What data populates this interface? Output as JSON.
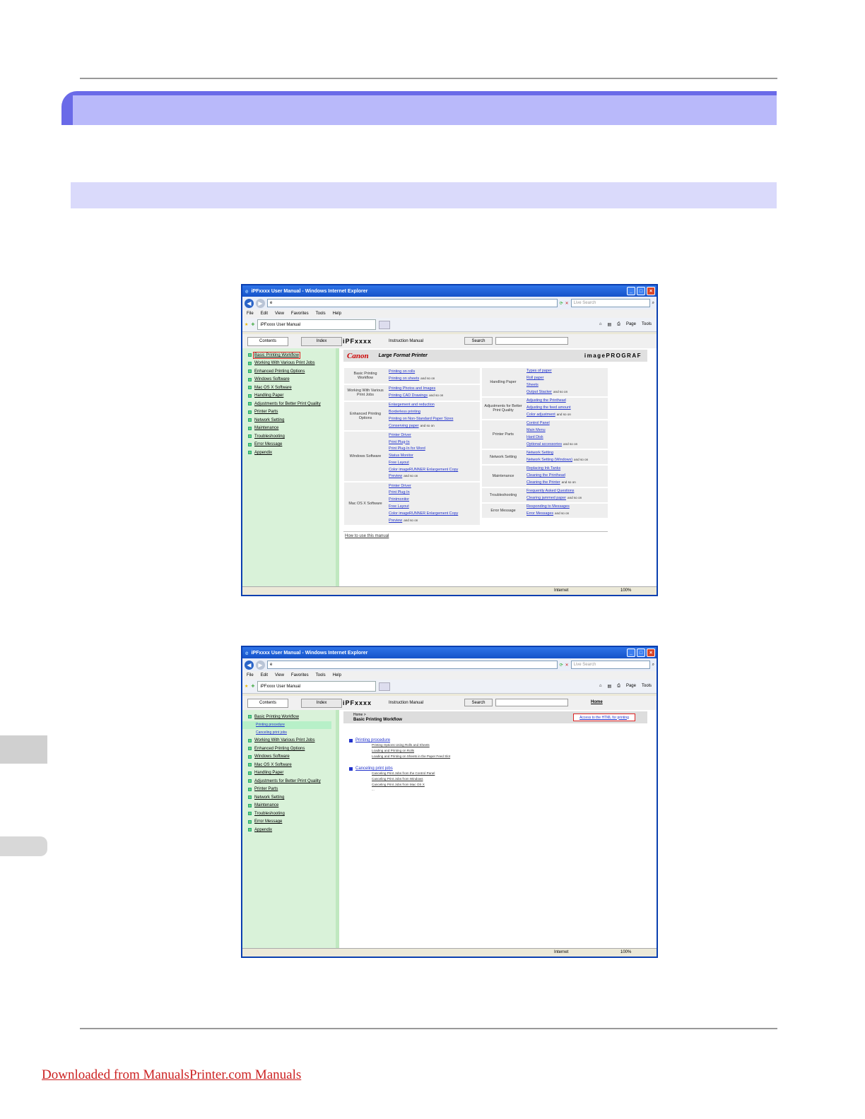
{
  "footer_link": "Downloaded from ManualsPrinter.com Manuals",
  "browser": {
    "title": "iPFxxxx User Manual - Windows Internet Explorer",
    "live_search_placeholder": "Live Search",
    "menu": [
      "File",
      "Edit",
      "View",
      "Favorites",
      "Tools",
      "Help"
    ],
    "tab_label": "iPFxxxx User Manual",
    "page_tool": "Page",
    "tools_tool": "Tools",
    "status_zone": "Internet",
    "status_zoom": "100%"
  },
  "manual": {
    "tab_contents": "Contents",
    "tab_index": "Index",
    "brand": "iPFxxxx",
    "instruction": "Instruction Manual",
    "search_button": "Search",
    "home_link": "Home"
  },
  "nav_items": [
    "Basic Printing Workflow",
    "Working With Various Print Jobs",
    "Enhanced Printing Options",
    "Windows Software",
    "Mac OS X Software",
    "Handling Paper",
    "Adjustments for Better Print Quality",
    "Printer Parts",
    "Network Setting",
    "Maintenance",
    "Troubleshooting",
    "Error Message",
    "Appendix"
  ],
  "nav_subitems": [
    "Printing procedure",
    "Canceling print jobs"
  ],
  "window1": {
    "canon_logo": "Canon",
    "lfp": "Large Format Printer",
    "imageprograf": "imagePROGRAF",
    "and_so_on": "and so on",
    "left_categories": [
      {
        "name": "Basic Printing Workflow",
        "links": [
          "Printing on rolls",
          "Printing on sheets"
        ]
      },
      {
        "name": "Working With Various Print Jobs",
        "links": [
          "Printing Photos and Images",
          "Printing CAD Drawings"
        ]
      },
      {
        "name": "Enhanced Printing Options",
        "links": [
          "Enlargement and reduction",
          "Borderless printing",
          "Printing on Non-Standard Paper Sizes",
          "Conserving paper"
        ]
      },
      {
        "name": "Windows Software",
        "links": [
          "Printer Driver",
          "Print Plug-In",
          "Print Plug-In for Word",
          "Status Monitor",
          "Free Layout",
          "Color imageRUNNER Enlargement Copy",
          "Preview"
        ]
      },
      {
        "name": "Mac OS X Software",
        "links": [
          "Printer Driver",
          "Print Plug-In",
          "Printmonitor",
          "Free Layout",
          "Color imageRUNNER Enlargement Copy",
          "Preview"
        ]
      }
    ],
    "right_categories": [
      {
        "name": "Handling Paper",
        "links": [
          "Types of paper",
          "Roll paper",
          "Sheets",
          "Output Stacker"
        ]
      },
      {
        "name": "Adjustments for Better Print Quality",
        "links": [
          "Adjusting the Printhead",
          "Adjusting the feed amount",
          "Color adjustment"
        ]
      },
      {
        "name": "Printer Parts",
        "links": [
          "Control Panel",
          "Main Menu",
          "Hard Disk",
          "Optional accessories"
        ]
      },
      {
        "name": "Network Setting",
        "links": [
          "Network Setting",
          "Network Setting (Windows)"
        ]
      },
      {
        "name": "Maintenance",
        "links": [
          "Replacing Ink Tanks",
          "Cleaning the Printhead",
          "Cleaning the Printer"
        ]
      },
      {
        "name": "Troubleshooting",
        "links": [
          "Frequently Asked Questions",
          "Clearing jammed paper"
        ]
      },
      {
        "name": "Error Message",
        "links": [
          "Responding to Messages",
          "Error Messages"
        ]
      }
    ],
    "how_to": "How to use this manual"
  },
  "window2": {
    "breadcrumb_home": "Home >",
    "page_title": "Basic Printing Workflow",
    "access_button": "Access to the HTML for printing",
    "sections": [
      {
        "title": "Printing procedure",
        "items": [
          "Printing Options Using Rolls and Sheets",
          "Loading and Printing on Rolls",
          "Loading and Printing on Sheets in the Paper Feed Slot"
        ]
      },
      {
        "title": "Canceling print jobs",
        "items": [
          "Canceling Print Jobs from the Control Panel",
          "Canceling Print Jobs from Windows",
          "Canceling Print Jobs from Mac OS X",
          "..."
        ]
      }
    ]
  }
}
